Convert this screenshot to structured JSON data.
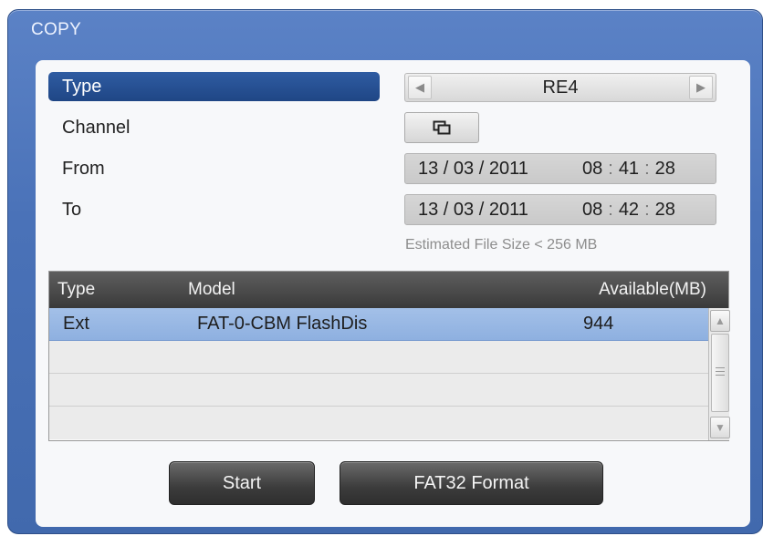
{
  "window": {
    "title": "COPY"
  },
  "labels": {
    "type": "Type",
    "channel": "Channel",
    "from": "From",
    "to": "To"
  },
  "type_selector": {
    "value": "RE4",
    "prev_icon": "triangle-left-icon",
    "next_icon": "triangle-right-icon"
  },
  "channel_button": {
    "icon": "channel-select-icon"
  },
  "from": {
    "date": "13 / 03 /  2011",
    "hour": "08",
    "minute": "41",
    "second": "28"
  },
  "to": {
    "date": "13 / 03 /  2011",
    "hour": "08",
    "minute": "42",
    "second": "28"
  },
  "estimate": "Estimated File Size < 256 MB",
  "devices": {
    "columns": {
      "type": "Type",
      "model": "Model",
      "available": "Available(MB)"
    },
    "rows": [
      {
        "type": "Ext",
        "model": "FAT-0-CBM FlashDis",
        "available": "944",
        "selected": true
      }
    ],
    "empty_rows": 3
  },
  "buttons": {
    "start": "Start",
    "format": "FAT32 Format"
  },
  "colors": {
    "window_bg": "#4a72b8",
    "selected_label_bg": "#24508f",
    "selected_row_bg": "#98b6e4",
    "header_bg": "#474747",
    "button_bg": "#3c3c3c"
  }
}
